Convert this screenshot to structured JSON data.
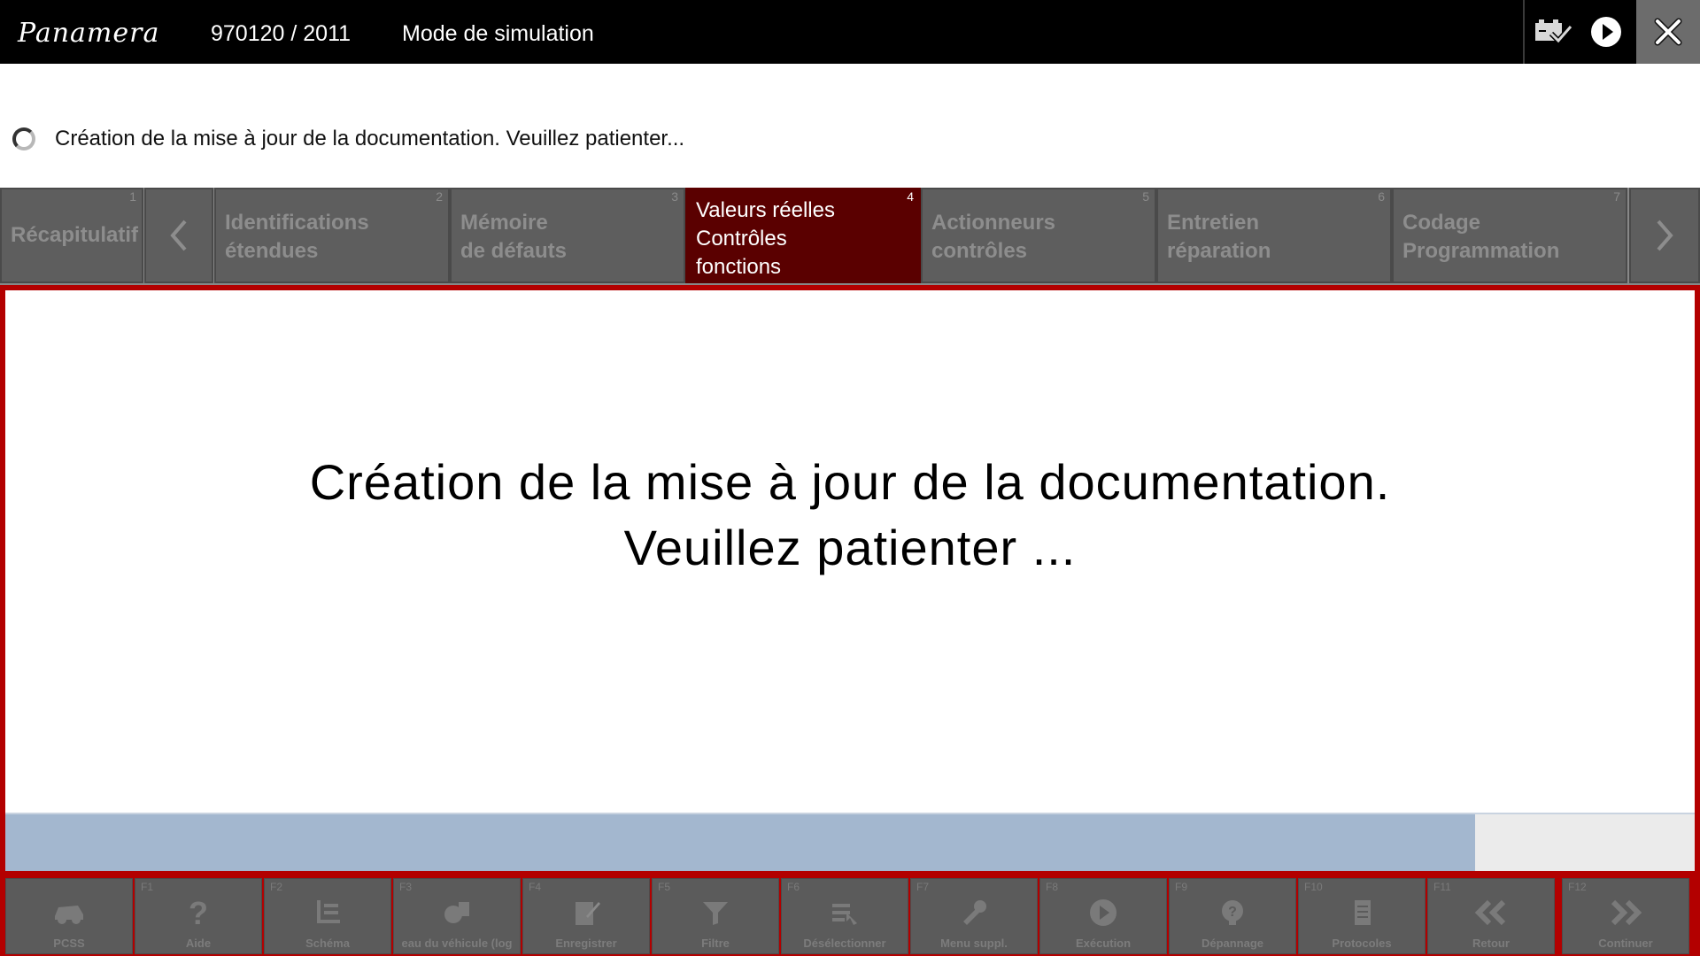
{
  "header": {
    "logo": "Panamera",
    "vehicle_id": "970120 / 2011",
    "mode": "Mode de simulation"
  },
  "status": {
    "text": "Création de la mise à jour de la documentation. Veuillez patienter..."
  },
  "tabs": [
    {
      "num": "1",
      "label": "Récapitulatif",
      "state": "disabled"
    },
    {
      "num": "",
      "label": "",
      "state": "prev-arrow"
    },
    {
      "num": "2",
      "label": "Identifications\nétendues",
      "state": "disabled"
    },
    {
      "num": "3",
      "label": "Mémoire\nde défauts",
      "state": "disabled"
    },
    {
      "num": "4",
      "label": "Valeurs réelles\nContrôles\nfonctions",
      "state": "active"
    },
    {
      "num": "5",
      "label": "Actionneurs\ncontrôles",
      "state": "disabled"
    },
    {
      "num": "6",
      "label": "Entretien\nréparation",
      "state": "disabled"
    },
    {
      "num": "7",
      "label": "Codage\nProgrammation",
      "state": "disabled"
    },
    {
      "num": "",
      "label": "",
      "state": "next-arrow"
    }
  ],
  "main": {
    "message_line1": "Création de la mise à jour de la documentation.",
    "message_line2": "Veuillez patienter ...",
    "progress_fraction": 0.87
  },
  "footer": {
    "buttons": [
      {
        "key": "",
        "label": "PCSS",
        "icon": "car-service-icon"
      },
      {
        "key": "F1",
        "label": "Aide",
        "icon": "help-icon"
      },
      {
        "key": "F2",
        "label": "Schéma",
        "icon": "schema-icon"
      },
      {
        "key": "F3",
        "label": "eau du véhicule (log",
        "icon": "vehicle-log-icon"
      },
      {
        "key": "F4",
        "label": "Enregistrer",
        "icon": "save-icon"
      },
      {
        "key": "F5",
        "label": "Filtre",
        "icon": "filter-icon"
      },
      {
        "key": "F6",
        "label": "Désélectionner",
        "icon": "deselect-icon"
      },
      {
        "key": "F7",
        "label": "Menu suppl.",
        "icon": "menu-extra-icon"
      },
      {
        "key": "F8",
        "label": "Exécution",
        "icon": "play-icon"
      },
      {
        "key": "F9",
        "label": "Dépannage",
        "icon": "troubleshoot-icon"
      },
      {
        "key": "F10",
        "label": "Protocoles",
        "icon": "protocol-icon"
      },
      {
        "key": "F11",
        "label": "Retour",
        "icon": "back-icon"
      },
      {
        "key": "F12",
        "label": "Continuer",
        "icon": "forward-icon"
      }
    ]
  },
  "colors": {
    "accent": "#b30000",
    "active_tab": "#5a0000",
    "header_bg": "#000000",
    "disabled_button": "#5b5b5b",
    "progress_fill": "#a3b7cf"
  }
}
